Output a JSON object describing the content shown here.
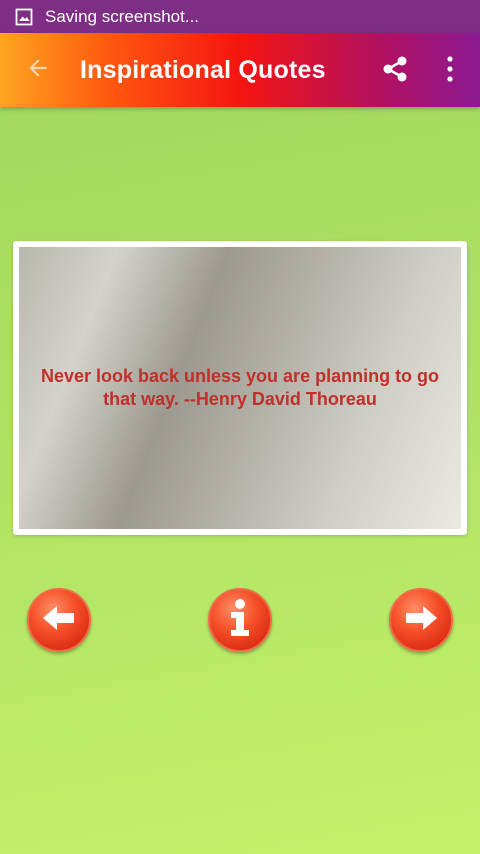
{
  "status_bar": {
    "notification_icon": "image-icon",
    "text": "Saving screenshot..."
  },
  "app_bar": {
    "back_icon": "arrow-left-icon",
    "title": "Inspirational Quotes",
    "share_icon": "share-icon",
    "overflow_icon": "more-vert-icon"
  },
  "quote": {
    "text": "Never look back unless you are planning to go that way. --Henry David Thoreau"
  },
  "controls": {
    "previous_icon": "arrow-left-icon",
    "info_icon": "info-icon",
    "next_icon": "arrow-right-icon"
  },
  "colors": {
    "status_bar": "#7e2e84",
    "quote_text": "#c0302a",
    "button": "#e6381a",
    "background": "#b0e064"
  }
}
